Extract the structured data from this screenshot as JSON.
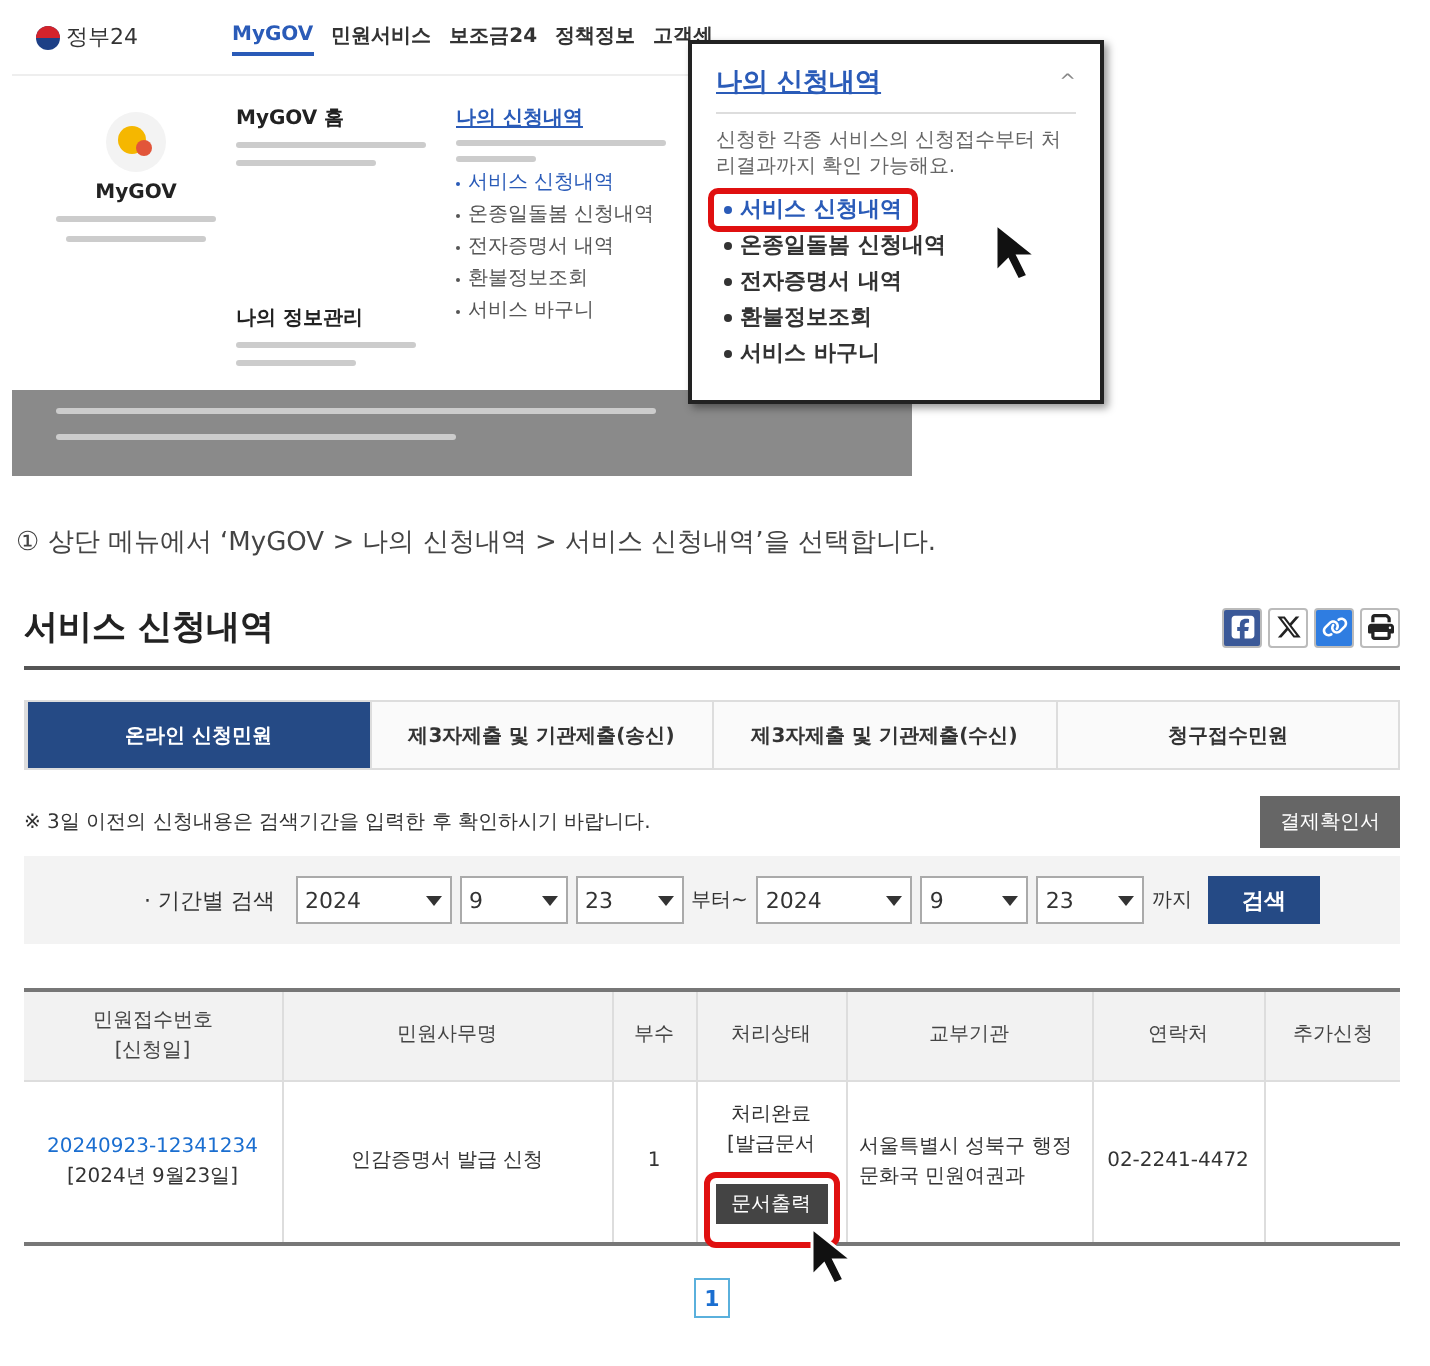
{
  "top_screenshot": {
    "logo": "정부24",
    "nav": [
      {
        "label": "MyGOV",
        "selected": true
      },
      {
        "label": "민원서비스",
        "selected": false
      },
      {
        "label": "보조금24",
        "selected": false
      },
      {
        "label": "정책정보",
        "selected": false
      },
      {
        "label": "고객센",
        "selected": false
      }
    ],
    "profile_title": "MyGOV",
    "sections": [
      {
        "title": "MyGOV 홈"
      },
      {
        "title": "나의 정보관리"
      }
    ],
    "submenu": {
      "title": "나의 신청내역",
      "items": [
        "서비스 신청내역",
        "온종일돌봄 신청내역",
        "전자증명서 내역",
        "환불정보조회",
        "서비스 바구니"
      ]
    },
    "popup": {
      "title": "나의 신청내역",
      "caret": "^",
      "description": "신청한 각종 서비스의 신청접수부터 처리결과까지 확인 가능해요.",
      "items": [
        {
          "label": "서비스 신청내역",
          "selected": true
        },
        {
          "label": "온종일돌봄 신청내역",
          "selected": false
        },
        {
          "label": "전자증명서 내역",
          "selected": false
        },
        {
          "label": "환불정보조회",
          "selected": false
        },
        {
          "label": "서비스 바구니",
          "selected": false
        }
      ]
    }
  },
  "caption": "① 상단 메뉴에서 ‘MyGOV > 나의 신청내역 > 서비스 신청내역’을 선택합니다.",
  "service_page": {
    "title": "서비스 신청내역",
    "tabs": [
      {
        "label": "온라인 신청민원",
        "selected": true
      },
      {
        "label": "제3자제출 및 기관제출(송신)",
        "selected": false
      },
      {
        "label": "제3자제출 및 기관제출(수신)",
        "selected": false
      },
      {
        "label": "청구접수민원",
        "selected": false
      }
    ],
    "notice": "※ 3일 이전의 신청내용은 검색기간을 입력한 후 확인하시기 바랍니다.",
    "receipt_button": "결제확인서",
    "search": {
      "label": "· 기간별 검색",
      "from": [
        "2024",
        "9",
        "23"
      ],
      "from_suffix": "부터~",
      "to": [
        "2024",
        "9",
        "23"
      ],
      "to_suffix": "까지",
      "button": "검색"
    },
    "table": {
      "columns": [
        "민원접수번호\n[신청일]",
        "민원사무명",
        "부수",
        "처리상태",
        "교부기관",
        "연락처",
        "추가신청"
      ],
      "rows": [
        {
          "number": "20240923-12341234",
          "date": "[2024년 9월23일]",
          "name": "인감증명서 발급 신청",
          "copies": "1",
          "status": [
            "처리완료",
            "[발급문서"
          ],
          "print_button": "문서출력",
          "office": "서울특별시 성북구 행정문화국 민원여권과",
          "phone": "02-2241-4472"
        }
      ]
    },
    "pages": [
      {
        "label": "1",
        "selected": true
      }
    ]
  }
}
